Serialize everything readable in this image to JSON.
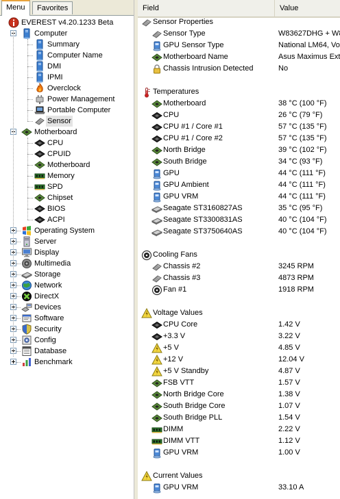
{
  "tabs": [
    {
      "label": "Menu",
      "active": true
    },
    {
      "label": "Favorites",
      "active": false
    }
  ],
  "tree": {
    "root": {
      "label": "EVEREST v4.20.1233 Beta",
      "icon": "info-icon"
    },
    "computer": {
      "label": "Computer",
      "icon": "computer-icon",
      "expanded": true,
      "children": [
        {
          "label": "Summary",
          "icon": "computer-summary-icon"
        },
        {
          "label": "Computer Name",
          "icon": "computer-name-icon"
        },
        {
          "label": "DMI",
          "icon": "dmi-icon"
        },
        {
          "label": "IPMI",
          "icon": "ipmi-icon"
        },
        {
          "label": "Overclock",
          "icon": "flame-icon"
        },
        {
          "label": "Power Management",
          "icon": "power-plug-icon"
        },
        {
          "label": "Portable Computer",
          "icon": "laptop-icon"
        },
        {
          "label": "Sensor",
          "icon": "sensor-chip-icon",
          "selected": true
        }
      ]
    },
    "motherboard": {
      "label": "Motherboard",
      "icon": "motherboard-icon",
      "expanded": true,
      "children": [
        {
          "label": "CPU",
          "icon": "cpu-chip-icon"
        },
        {
          "label": "CPUID",
          "icon": "cpuid-chip-icon"
        },
        {
          "label": "Motherboard",
          "icon": "motherboard-icon"
        },
        {
          "label": "Memory",
          "icon": "memory-module-icon"
        },
        {
          "label": "SPD",
          "icon": "spd-module-icon"
        },
        {
          "label": "Chipset",
          "icon": "chipset-icon"
        },
        {
          "label": "BIOS",
          "icon": "bios-chip-icon"
        },
        {
          "label": "ACPI",
          "icon": "acpi-chip-icon"
        }
      ]
    },
    "collapsed": [
      {
        "label": "Operating System",
        "icon": "windows-logo-icon"
      },
      {
        "label": "Server",
        "icon": "server-icon"
      },
      {
        "label": "Display",
        "icon": "monitor-icon"
      },
      {
        "label": "Multimedia",
        "icon": "speaker-icon"
      },
      {
        "label": "Storage",
        "icon": "hard-disk-icon"
      },
      {
        "label": "Network",
        "icon": "globe-network-icon"
      },
      {
        "label": "DirectX",
        "icon": "directx-icon"
      },
      {
        "label": "Devices",
        "icon": "devices-icon"
      },
      {
        "label": "Software",
        "icon": "software-icon"
      },
      {
        "label": "Security",
        "icon": "shield-icon"
      },
      {
        "label": "Config",
        "icon": "config-icon"
      },
      {
        "label": "Database",
        "icon": "database-icon"
      },
      {
        "label": "Benchmark",
        "icon": "benchmark-icon"
      }
    ]
  },
  "list": {
    "columns": {
      "field": "Field",
      "value": "Value"
    },
    "groups": [
      {
        "title": "Sensor Properties",
        "icon": "sensor-chip-icon",
        "items": [
          {
            "field": "Sensor Type",
            "value": "W83627DHG + W8",
            "icon": "sensor-chip-icon"
          },
          {
            "field": "GPU Sensor Type",
            "value": "National LM64, Vol",
            "icon": "gpu-chip-icon"
          },
          {
            "field": "Motherboard Name",
            "value": "Asus Maximus Extr",
            "icon": "motherboard-icon"
          },
          {
            "field": "Chassis Intrusion Detected",
            "value": "No",
            "icon": "padlock-icon"
          }
        ]
      },
      {
        "title": "Temperatures",
        "icon": "thermometer-icon",
        "items": [
          {
            "field": "Motherboard",
            "value": "38 °C  (100 °F)",
            "icon": "motherboard-icon"
          },
          {
            "field": "CPU",
            "value": "26 °C  (79 °F)",
            "icon": "cpu-chip-icon"
          },
          {
            "field": "CPU #1 / Core #1",
            "value": "57 °C  (135 °F)",
            "icon": "cpu-chip-icon"
          },
          {
            "field": "CPU #1 / Core #2",
            "value": "57 °C  (135 °F)",
            "icon": "cpu-chip-icon"
          },
          {
            "field": "North Bridge",
            "value": "39 °C  (102 °F)",
            "icon": "chipset-icon"
          },
          {
            "field": "South Bridge",
            "value": "34 °C  (93 °F)",
            "icon": "chipset-icon"
          },
          {
            "field": "GPU",
            "value": "44 °C  (111 °F)",
            "icon": "gpu-chip-icon"
          },
          {
            "field": "GPU Ambient",
            "value": "44 °C  (111 °F)",
            "icon": "gpu-chip-icon"
          },
          {
            "field": "GPU VRM",
            "value": "44 °C  (111 °F)",
            "icon": "gpu-chip-icon"
          },
          {
            "field": "Seagate ST3160827AS",
            "value": "35 °C  (95 °F)",
            "icon": "hard-disk-icon"
          },
          {
            "field": "Seagate ST3300831AS",
            "value": "40 °C  (104 °F)",
            "icon": "hard-disk-icon"
          },
          {
            "field": "Seagate ST3750640AS",
            "value": "40 °C  (104 °F)",
            "icon": "hard-disk-icon"
          }
        ]
      },
      {
        "title": "Cooling Fans",
        "icon": "fan-icon",
        "items": [
          {
            "field": "Chassis #2",
            "value": "3245 RPM",
            "icon": "chassis-icon"
          },
          {
            "field": "Chassis #3",
            "value": "4873 RPM",
            "icon": "chassis-icon"
          },
          {
            "field": "Fan #1",
            "value": "1918 RPM",
            "icon": "fan-icon"
          }
        ]
      },
      {
        "title": "Voltage Values",
        "icon": "voltage-icon",
        "items": [
          {
            "field": "CPU Core",
            "value": "1.42 V",
            "icon": "cpu-chip-icon"
          },
          {
            "field": "+3.3 V",
            "value": "3.22 V",
            "icon": "cpu-chip-icon"
          },
          {
            "field": "+5 V",
            "value": "4.85 V",
            "icon": "voltage-icon"
          },
          {
            "field": "+12 V",
            "value": "12.04 V",
            "icon": "voltage-icon"
          },
          {
            "field": "+5 V Standby",
            "value": "4.87 V",
            "icon": "voltage-icon"
          },
          {
            "field": "FSB VTT",
            "value": "1.57 V",
            "icon": "chipset-icon"
          },
          {
            "field": "North Bridge Core",
            "value": "1.38 V",
            "icon": "chipset-icon"
          },
          {
            "field": "South Bridge Core",
            "value": "1.07 V",
            "icon": "chipset-icon"
          },
          {
            "field": "South Bridge PLL",
            "value": "1.54 V",
            "icon": "chipset-icon"
          },
          {
            "field": "DIMM",
            "value": "2.22 V",
            "icon": "memory-module-icon"
          },
          {
            "field": "DIMM VTT",
            "value": "1.12 V",
            "icon": "memory-module-icon"
          },
          {
            "field": "GPU VRM",
            "value": "1.00 V",
            "icon": "gpu-chip-icon"
          }
        ]
      },
      {
        "title": "Current Values",
        "icon": "voltage-icon",
        "items": [
          {
            "field": "GPU VRM",
            "value": "33.10 A",
            "icon": "gpu-chip-icon"
          }
        ]
      }
    ]
  },
  "colors": {
    "tab_active_accent": "#e8a33d",
    "selection": "#e4e4e4",
    "chrome": "#ece9d8"
  }
}
